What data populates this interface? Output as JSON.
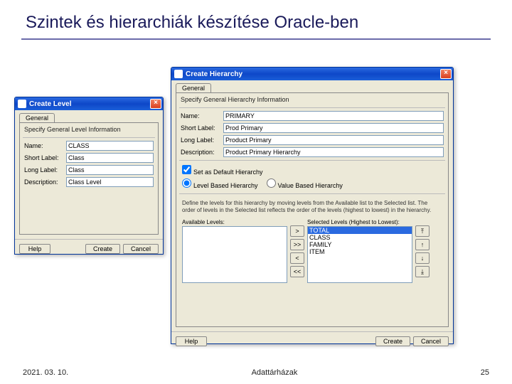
{
  "slide": {
    "title": "Szintek és hierarchiák készítése Oracle-ben",
    "footer_left": "2021. 03. 10.",
    "footer_center": "Adattárházak",
    "footer_right": "25"
  },
  "level_win": {
    "title": "Create Level",
    "tab": "General",
    "section": "Specify General Level Information",
    "name_lbl": "Name:",
    "name_val": "CLASS",
    "short_lbl": "Short Label:",
    "short_val": "Class",
    "long_lbl": "Long Label:",
    "long_val": "Class",
    "desc_lbl": "Description:",
    "desc_val": "Class Level",
    "help": "Help",
    "create": "Create",
    "cancel": "Cancel"
  },
  "hier_win": {
    "title": "Create Hierarchy",
    "tab": "General",
    "section": "Specify General Hierarchy Information",
    "name_lbl": "Name:",
    "name_val": "PRIMARY",
    "short_lbl": "Short Label:",
    "short_val": "Prod Primary",
    "long_lbl": "Long Label:",
    "long_val": "Product Primary",
    "desc_lbl": "Description:",
    "desc_val": "Product Primary Hierarchy",
    "default_cb": "Set as Default Hierarchy",
    "rb_level": "Level Based Hierarchy",
    "rb_value": "Value Based Hierarchy",
    "instr": "Define the levels for this hierarchy by moving levels from the Available list to the Selected list. The order of levels in the Selected list reflects the order of the levels (highest to lowest) in the hierarchy.",
    "avail_lbl": "Available Levels:",
    "sel_lbl": "Selected Levels (Highest to Lowest):",
    "sel_items": {
      "0": "TOTAL",
      "1": "CLASS",
      "2": "FAMILY",
      "3": "ITEM"
    },
    "help": "Help",
    "create": "Create",
    "cancel": "Cancel",
    "shuttle": {
      "add": ">",
      "addall": ">>",
      "rem": "<",
      "remall": "<<"
    }
  }
}
